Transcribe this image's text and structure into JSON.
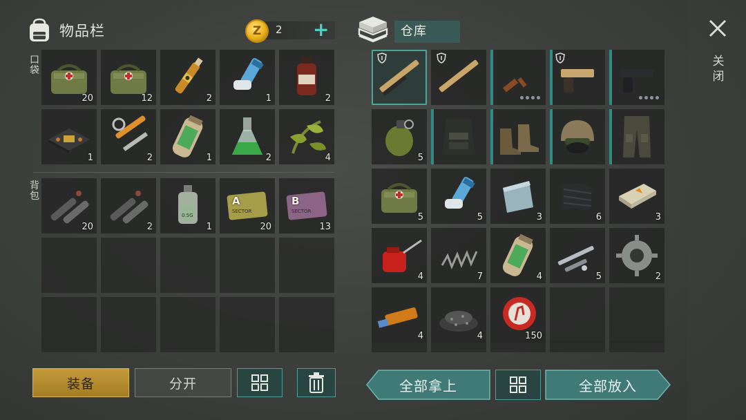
{
  "inventory": {
    "title": "物品栏",
    "pocket_label": "口袋",
    "backpack_label": "背包",
    "coins": {
      "icon_letter": "Z",
      "count": "2",
      "add_symbol": "+"
    },
    "pocket_slots": [
      {
        "item": "medkit-bag",
        "count": "20"
      },
      {
        "item": "medkit-bag",
        "count": "12"
      },
      {
        "item": "ampoule",
        "count": "2"
      },
      {
        "item": "inhaler",
        "count": "1"
      },
      {
        "item": "medicine-bottle",
        "count": "2"
      },
      {
        "item": "circuit-board",
        "count": "1"
      },
      {
        "item": "hydraulic-parts",
        "count": "2"
      },
      {
        "item": "chemical-canister",
        "count": "1"
      },
      {
        "item": "flask",
        "count": "2"
      },
      {
        "item": "herbs",
        "count": "4"
      }
    ],
    "backpack_slots": [
      {
        "item": "pipe-parts",
        "count": "20"
      },
      {
        "item": "pipe-parts",
        "count": "2"
      },
      {
        "item": "small-bottle",
        "count": "1",
        "label": "0.5G"
      },
      {
        "item": "keycard-a",
        "count": "20",
        "letter": "A",
        "card_text": "SECTOR"
      },
      {
        "item": "keycard-b",
        "count": "13",
        "letter": "B",
        "card_text": "SECTOR"
      }
    ]
  },
  "warehouse": {
    "title": "仓库",
    "slots": [
      {
        "item": "shotgun",
        "count": "",
        "shield": true,
        "selected": true
      },
      {
        "item": "shotgun",
        "count": "",
        "shield": true
      },
      {
        "item": "assault-rifle",
        "count": "",
        "edge": true,
        "dots": 4
      },
      {
        "item": "pistol-gold",
        "count": "",
        "shield": true,
        "edge": true
      },
      {
        "item": "pistol",
        "count": "",
        "edge": true,
        "dots": 4
      },
      {
        "item": "grenade",
        "count": "5"
      },
      {
        "item": "tactical-vest",
        "count": "",
        "edge": true
      },
      {
        "item": "combat-boots",
        "count": "",
        "edge": true
      },
      {
        "item": "helmet",
        "count": "",
        "edge": true
      },
      {
        "item": "combat-pants",
        "count": "",
        "edge": true
      },
      {
        "item": "medkit-bag",
        "count": "5"
      },
      {
        "item": "inhaler",
        "count": "5"
      },
      {
        "item": "metal-plate",
        "count": "3"
      },
      {
        "item": "fabric-roll",
        "count": "6"
      },
      {
        "item": "eraser-box",
        "count": "3"
      },
      {
        "item": "oil-can",
        "count": "4"
      },
      {
        "item": "spring",
        "count": "7"
      },
      {
        "item": "chemical-canister",
        "count": "4"
      },
      {
        "item": "gun-parts",
        "count": "5"
      },
      {
        "item": "gear",
        "count": "2"
      },
      {
        "item": "usb-drive",
        "count": "4"
      },
      {
        "item": "gravel-pile",
        "count": "4"
      },
      {
        "item": "bottle-cap",
        "count": "150"
      },
      {
        "item": "",
        "count": ""
      },
      {
        "item": "",
        "count": ""
      }
    ]
  },
  "close": {
    "label": "关闭"
  },
  "buttons": {
    "equip": "装备",
    "split": "分开",
    "take_all": "全部拿上",
    "put_all": "全部放入"
  },
  "colors": {
    "accent": "#4fd0c4",
    "equip": "#c49a3a",
    "teal": "#2f8c85",
    "coin": "#e8b21d"
  }
}
